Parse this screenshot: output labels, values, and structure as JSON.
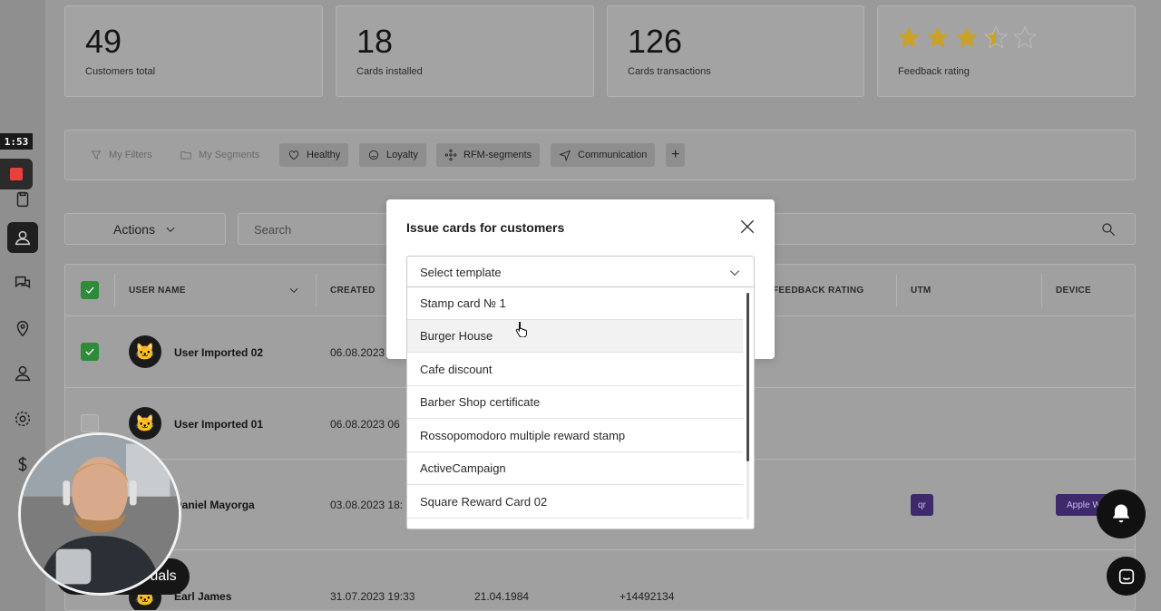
{
  "recording": {
    "timer": "1:53"
  },
  "stats": [
    {
      "value": "49",
      "label": "Customers total"
    },
    {
      "value": "18",
      "label": "Cards installed"
    },
    {
      "value": "126",
      "label": "Cards transactions"
    },
    {
      "label": "Feedback rating",
      "rating": 3.5,
      "max": 5
    }
  ],
  "filters": {
    "my_filters": "My Filters",
    "my_segments": "My Segments",
    "healthy": "Healthy",
    "loyalty": "Loyalty",
    "rfm": "RFM-segments",
    "communication": "Communication",
    "add": "+"
  },
  "toolbar": {
    "actions_label": "Actions",
    "search_placeholder": "Search"
  },
  "table": {
    "headers": {
      "user_name": "USER NAME",
      "created": "CREATED",
      "feedback": "FEEDBACK RATING",
      "utm": "UTM",
      "device": "DEVICE"
    },
    "rows": [
      {
        "name": "User Imported 02",
        "created": "06.08.2023",
        "checked": true
      },
      {
        "name": "User Imported 01",
        "created": "06.08.2023 06",
        "checked": false
      },
      {
        "name": "Daniel Mayorga",
        "created": "03.08.2023 18:",
        "utm": "qr",
        "device": "Apple W"
      },
      {
        "name": "Earl James",
        "created": "31.07.2023 19:33",
        "birthday": "21.04.1984",
        "phone": "+14492134"
      }
    ]
  },
  "modal": {
    "title": "Issue cards for customers",
    "select_placeholder": "Select template",
    "options": [
      "Stamp card № 1",
      "Burger House",
      "Cafe discount",
      "Barber Shop certificate",
      "Rossopomodoro multiple reward stamp",
      "ActiveCampaign",
      "Square Reward Card 02"
    ]
  },
  "overlay": {
    "pill_text": "crüals"
  },
  "colors": {
    "check_green": "#2f8a3a",
    "star_gold": "#e0b320",
    "tag_purple": "#3e2a6a",
    "record_red": "#e8413a"
  }
}
